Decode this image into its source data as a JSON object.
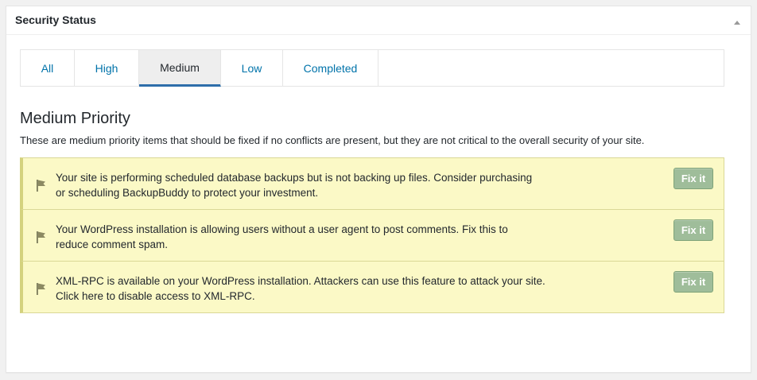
{
  "panel": {
    "title": "Security Status"
  },
  "tabs": [
    {
      "label": "All"
    },
    {
      "label": "High"
    },
    {
      "label": "Medium"
    },
    {
      "label": "Low"
    },
    {
      "label": "Completed"
    }
  ],
  "active_tab": "Medium",
  "section": {
    "title": "Medium Priority",
    "description": "These are medium priority items that should be fixed if no conflicts are present, but they are not critical to the overall security of your site."
  },
  "items": [
    {
      "text_line1": "Your site is performing scheduled database backups but is not backing up files. Consider purchasing",
      "text_line2": "or scheduling BackupBuddy to protect your investment.",
      "button": "Fix it"
    },
    {
      "text_line1": "Your WordPress installation is allowing users without a user agent to post comments. Fix this to",
      "text_line2": "reduce comment spam.",
      "button": "Fix it"
    },
    {
      "text_line1": "XML-RPC is available on your WordPress installation. Attackers can use this feature to attack your site.",
      "text_line2": "Click here to disable access to XML-RPC.",
      "button": "Fix it"
    }
  ],
  "colors": {
    "link": "#0073aa",
    "active_tab_underline": "#2e6eaa",
    "item_background": "#fbf9c6",
    "item_accent": "#d4d27e",
    "fix_button": "#9fbd9a"
  }
}
